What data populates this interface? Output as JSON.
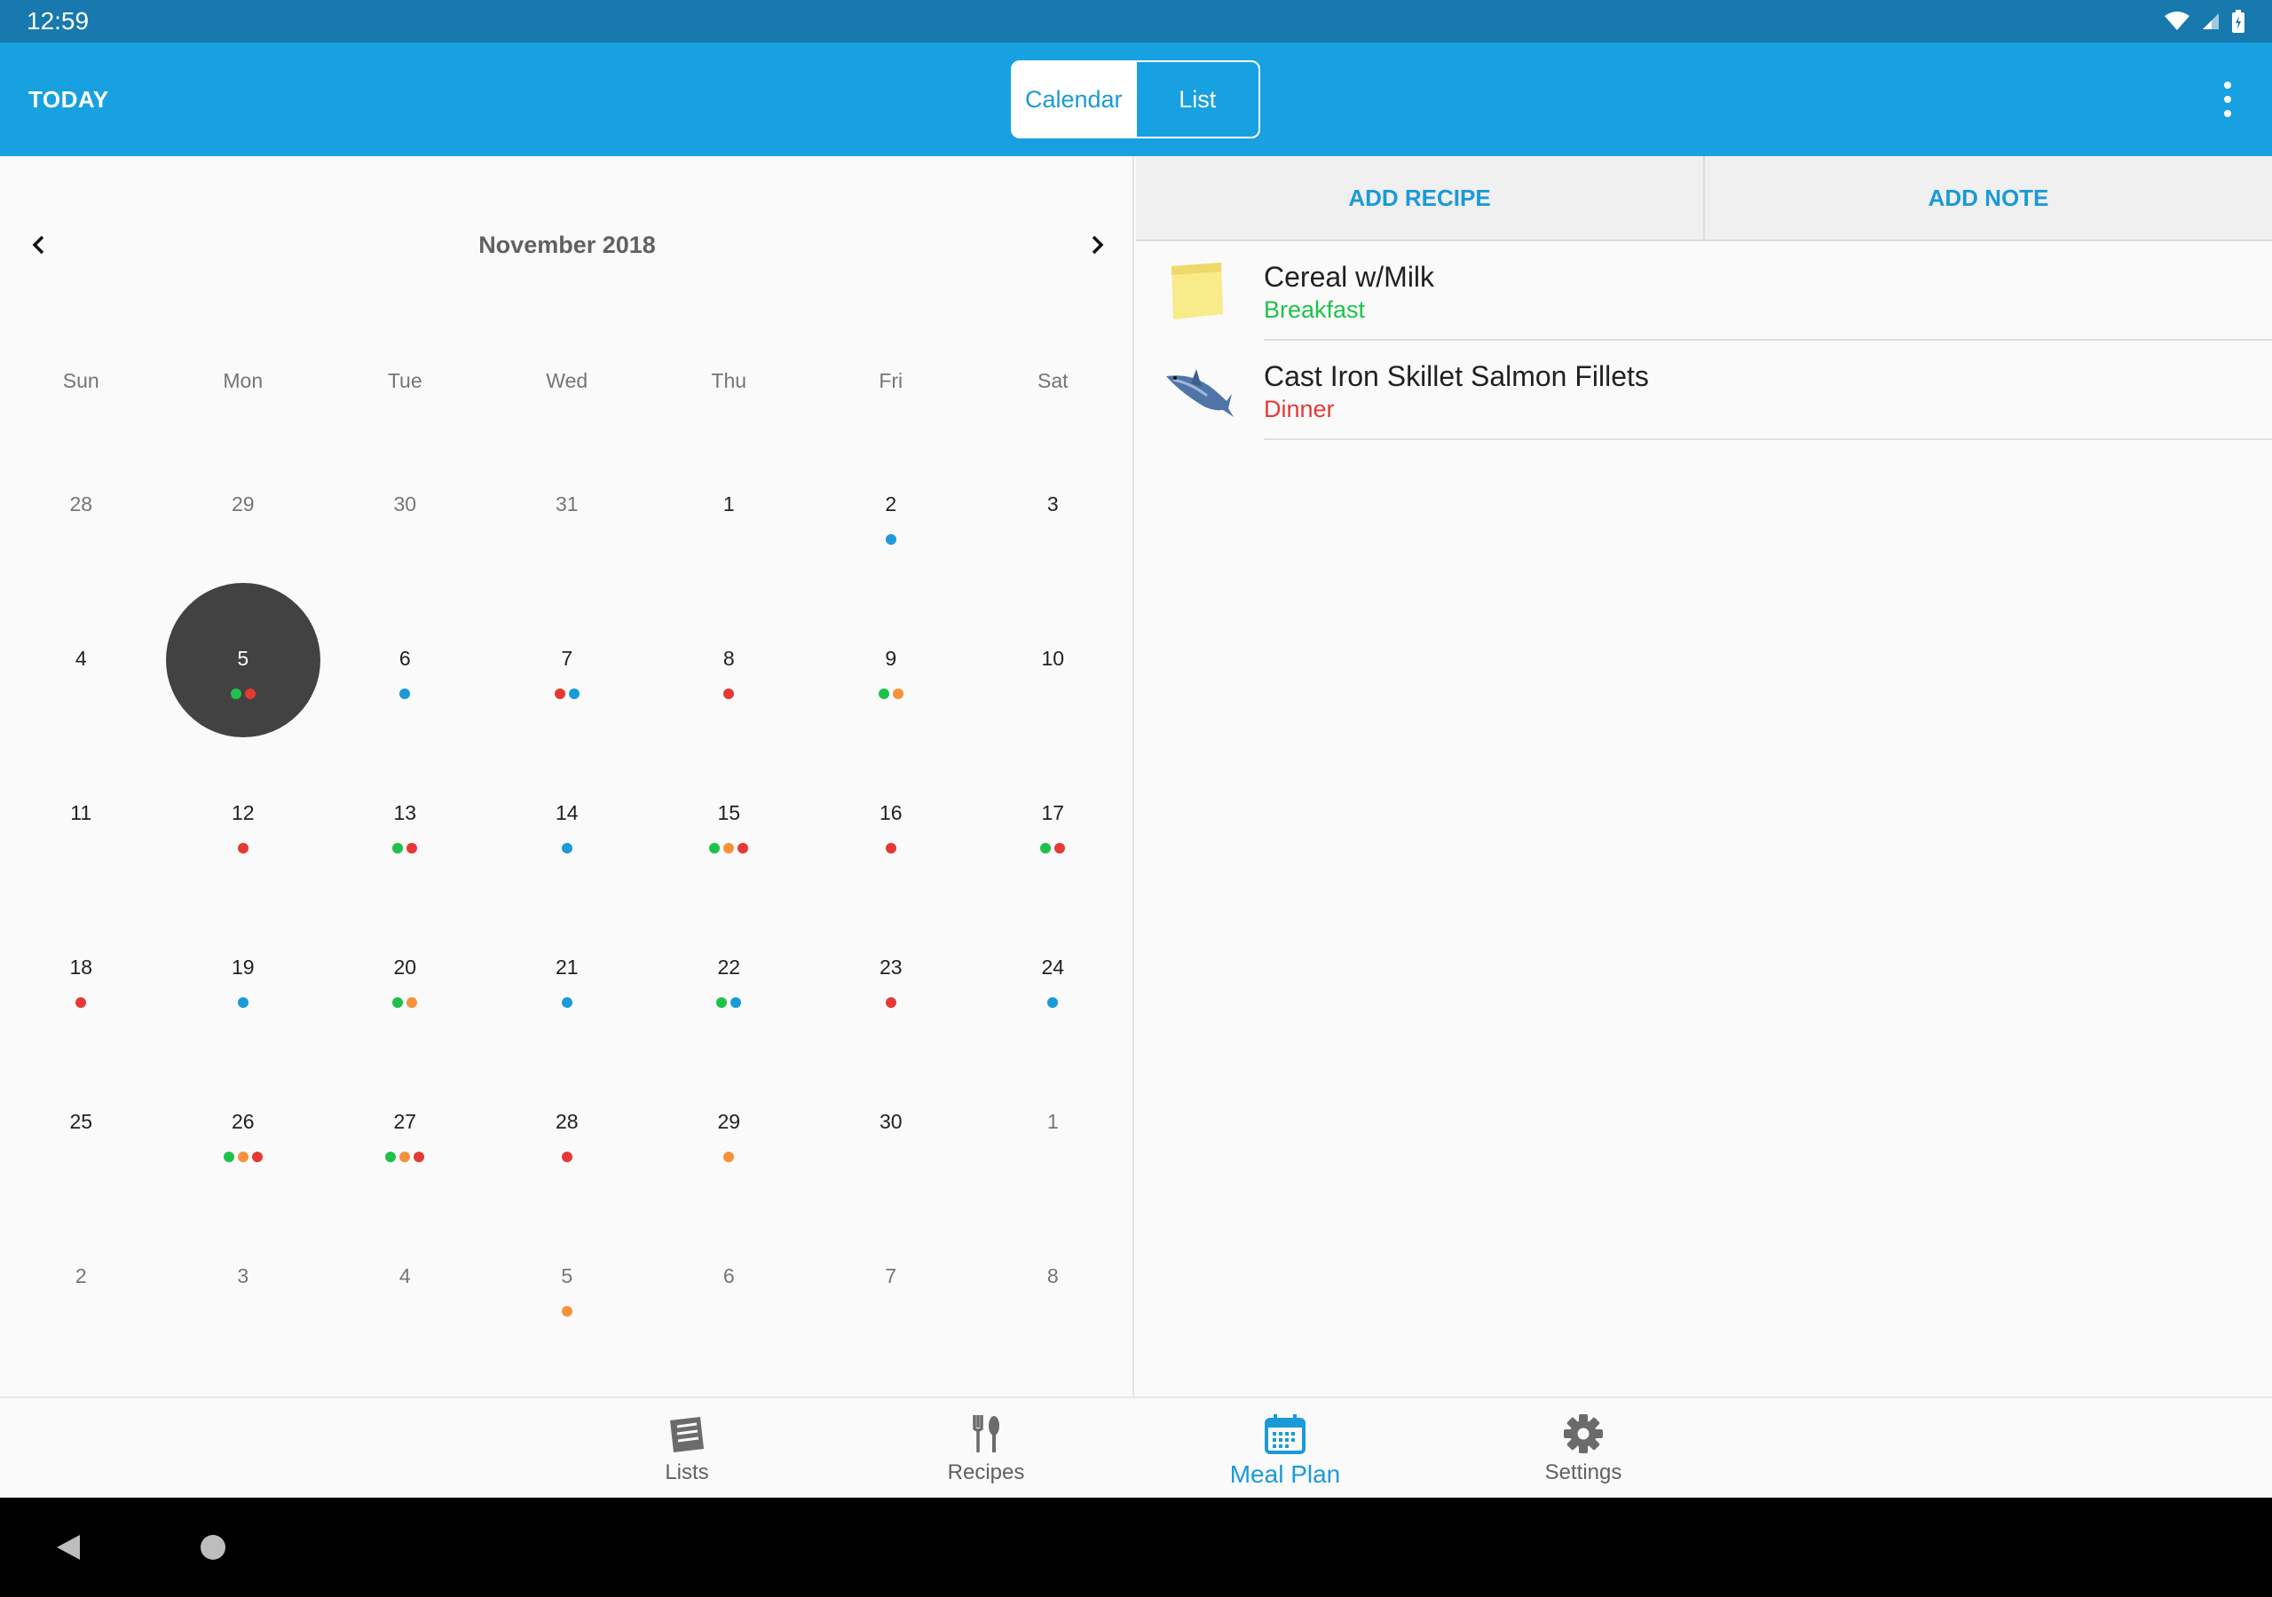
{
  "status_bar": {
    "time": "12:59",
    "icons": [
      "wifi-icon",
      "signal-icon",
      "battery-charging-icon"
    ]
  },
  "app_bar": {
    "today_label": "TODAY",
    "view_toggle": {
      "calendar_label": "Calendar",
      "list_label": "List",
      "selected": "Calendar"
    },
    "overflow_icon": "more-vert-icon"
  },
  "calendar": {
    "month_label": "November 2018",
    "prev_icon": "chevron-left-icon",
    "next_icon": "chevron-right-icon",
    "weekdays": [
      "Sun",
      "Mon",
      "Tue",
      "Wed",
      "Thu",
      "Fri",
      "Sat"
    ],
    "selected_day": "5",
    "weeks": [
      [
        {
          "d": "28",
          "other": true,
          "dots": []
        },
        {
          "d": "29",
          "other": true,
          "dots": []
        },
        {
          "d": "30",
          "other": true,
          "dots": []
        },
        {
          "d": "31",
          "other": true,
          "dots": []
        },
        {
          "d": "1",
          "other": false,
          "dots": []
        },
        {
          "d": "2",
          "other": false,
          "dots": [
            "blue"
          ]
        },
        {
          "d": "3",
          "other": false,
          "dots": []
        }
      ],
      [
        {
          "d": "4",
          "other": false,
          "dots": []
        },
        {
          "d": "5",
          "other": false,
          "dots": [
            "green",
            "red"
          ],
          "selected": true
        },
        {
          "d": "6",
          "other": false,
          "dots": [
            "blue"
          ]
        },
        {
          "d": "7",
          "other": false,
          "dots": [
            "red",
            "blue"
          ]
        },
        {
          "d": "8",
          "other": false,
          "dots": [
            "red"
          ]
        },
        {
          "d": "9",
          "other": false,
          "dots": [
            "green",
            "orange"
          ]
        },
        {
          "d": "10",
          "other": false,
          "dots": []
        }
      ],
      [
        {
          "d": "11",
          "other": false,
          "dots": []
        },
        {
          "d": "12",
          "other": false,
          "dots": [
            "red"
          ]
        },
        {
          "d": "13",
          "other": false,
          "dots": [
            "green",
            "red"
          ]
        },
        {
          "d": "14",
          "other": false,
          "dots": [
            "blue"
          ]
        },
        {
          "d": "15",
          "other": false,
          "dots": [
            "green",
            "orange",
            "red"
          ]
        },
        {
          "d": "16",
          "other": false,
          "dots": [
            "red"
          ]
        },
        {
          "d": "17",
          "other": false,
          "dots": [
            "green",
            "red"
          ]
        }
      ],
      [
        {
          "d": "18",
          "other": false,
          "dots": [
            "red"
          ]
        },
        {
          "d": "19",
          "other": false,
          "dots": [
            "blue"
          ]
        },
        {
          "d": "20",
          "other": false,
          "dots": [
            "green",
            "orange"
          ]
        },
        {
          "d": "21",
          "other": false,
          "dots": [
            "blue"
          ]
        },
        {
          "d": "22",
          "other": false,
          "dots": [
            "green",
            "blue"
          ]
        },
        {
          "d": "23",
          "other": false,
          "dots": [
            "red"
          ]
        },
        {
          "d": "24",
          "other": false,
          "dots": [
            "blue"
          ]
        }
      ],
      [
        {
          "d": "25",
          "other": false,
          "dots": []
        },
        {
          "d": "26",
          "other": false,
          "dots": [
            "green",
            "orange",
            "red"
          ]
        },
        {
          "d": "27",
          "other": false,
          "dots": [
            "green",
            "orange",
            "red"
          ]
        },
        {
          "d": "28",
          "other": false,
          "dots": [
            "red"
          ]
        },
        {
          "d": "29",
          "other": false,
          "dots": [
            "orange"
          ]
        },
        {
          "d": "30",
          "other": false,
          "dots": []
        },
        {
          "d": "1",
          "other": true,
          "dots": []
        }
      ],
      [
        {
          "d": "2",
          "other": true,
          "dots": []
        },
        {
          "d": "3",
          "other": true,
          "dots": []
        },
        {
          "d": "4",
          "other": true,
          "dots": []
        },
        {
          "d": "5",
          "other": true,
          "dots": [
            "orange"
          ]
        },
        {
          "d": "6",
          "other": true,
          "dots": []
        },
        {
          "d": "7",
          "other": true,
          "dots": []
        },
        {
          "d": "8",
          "other": true,
          "dots": []
        }
      ]
    ]
  },
  "dot_colors": {
    "green": "#1ec24a",
    "red": "#e53935",
    "blue": "#1a9ad8",
    "orange": "#f6923a"
  },
  "meal_panel": {
    "add_recipe_label": "ADD RECIPE",
    "add_note_label": "ADD NOTE",
    "items": [
      {
        "title": "Cereal w/Milk",
        "category": "Breakfast",
        "category_color": "#1ec24a",
        "icon": "sticky-note-icon"
      },
      {
        "title": "Cast Iron Skillet Salmon Fillets",
        "category": "Dinner",
        "category_color": "#e53935",
        "icon": "fish-icon"
      }
    ]
  },
  "bottom_nav": {
    "tabs": [
      {
        "label": "Lists",
        "icon": "list-icon",
        "active": false
      },
      {
        "label": "Recipes",
        "icon": "fork-spoon-icon",
        "active": false
      },
      {
        "label": "Meal Plan",
        "icon": "calendar-icon",
        "active": true
      },
      {
        "label": "Settings",
        "icon": "gear-icon",
        "active": false
      }
    ]
  },
  "system_nav": {
    "icons": [
      "back-icon",
      "home-icon"
    ]
  },
  "colors": {
    "status_bar": "#1779ad",
    "app_bar": "#18a1e0",
    "accent": "#1a9ad8"
  }
}
